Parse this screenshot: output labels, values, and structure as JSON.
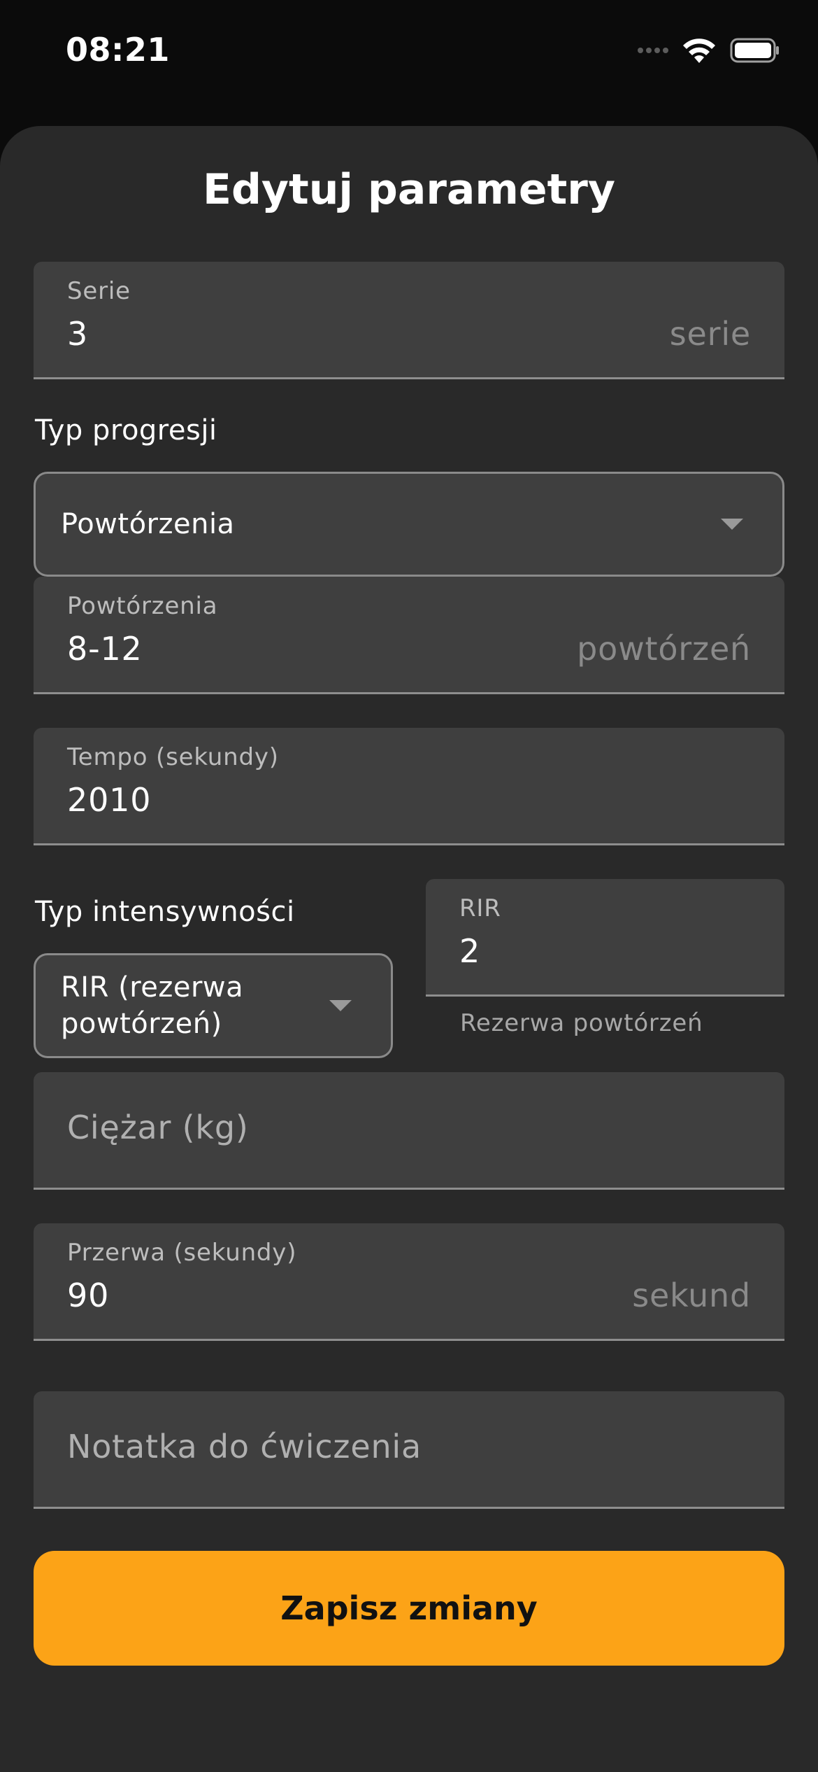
{
  "status_bar": {
    "time": "08:21",
    "icons": [
      "cellular-signal-icon",
      "wifi-icon",
      "battery-icon"
    ]
  },
  "sheet": {
    "title": "Edytuj parametry"
  },
  "form": {
    "series": {
      "label": "Serie",
      "value": "3",
      "suffix": "serie"
    },
    "progression_type": {
      "label": "Typ progresji",
      "selected": "Powtórzenia"
    },
    "reps": {
      "label": "Powtórzenia",
      "value": "8-12",
      "suffix": "powtórzeń"
    },
    "tempo": {
      "label": "Tempo (sekundy)",
      "value": "2010"
    },
    "intensity_type": {
      "label": "Typ intensywności",
      "selected": "RIR (rezerwa powtórzeń)"
    },
    "rir": {
      "label": "RIR",
      "value": "2",
      "helper": "Rezerwa powtórzeń"
    },
    "weight": {
      "placeholder": "Ciężar (kg)"
    },
    "rest": {
      "label": "Przerwa (sekundy)",
      "value": "90",
      "suffix": "sekund"
    },
    "note": {
      "placeholder": "Notatka do ćwiczenia"
    }
  },
  "actions": {
    "save_label": "Zapisz zmiany"
  },
  "colors": {
    "background": "#0b0b0b",
    "sheet": "#292929",
    "field": "#3f3f3f",
    "accent": "#fca317"
  }
}
